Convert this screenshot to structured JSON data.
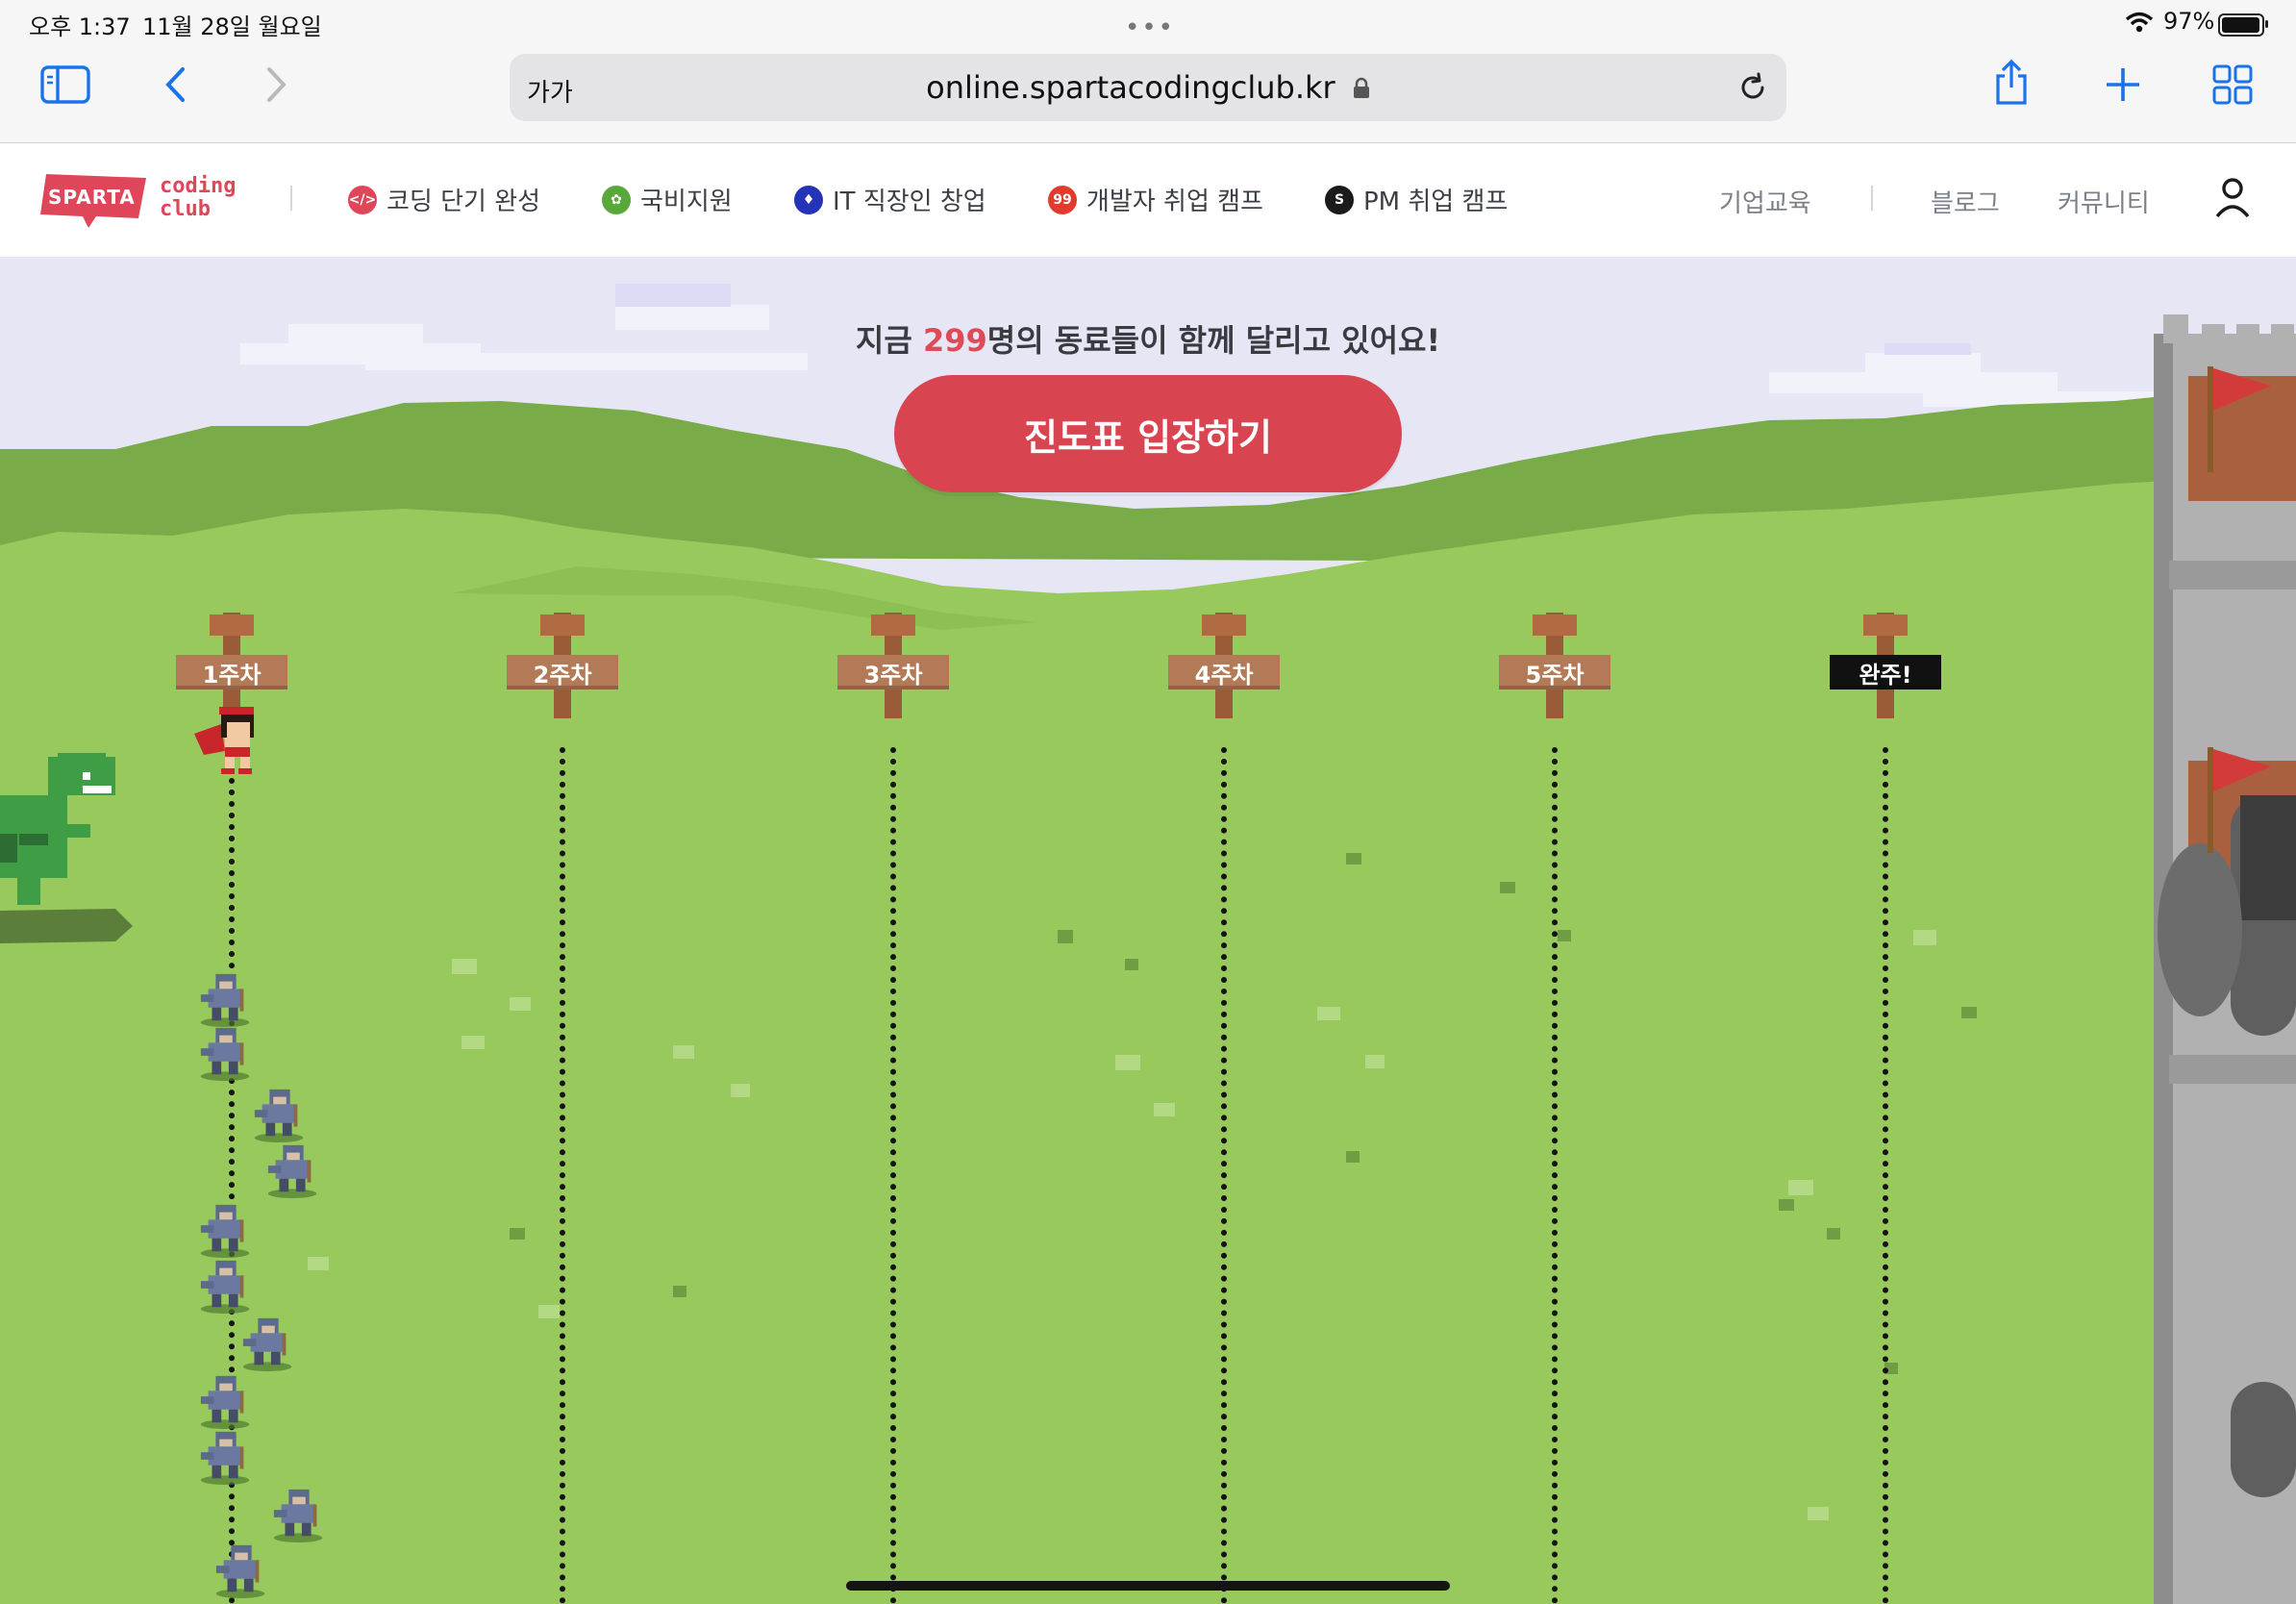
{
  "status_bar": {
    "time": "오후 1:37",
    "date": "11월 28일 월요일",
    "battery": "97%",
    "battery_level": 0.97
  },
  "browser": {
    "reader_label": "가가",
    "url": "online.spartacodingclub.kr"
  },
  "site": {
    "logo": {
      "brand": "SPARTA",
      "line1": "coding",
      "line2": "club"
    },
    "nav": [
      {
        "label": "코딩 단기 완성",
        "icon": "code-icon",
        "color": "#e0465a"
      },
      {
        "label": "국비지원",
        "icon": "sprout-icon",
        "color": "#59a83a"
      },
      {
        "label": "IT 직장인 창업",
        "icon": "flame-icon",
        "color": "#2533b8"
      },
      {
        "label": "개발자 취업 캠프",
        "icon": "99-icon",
        "color": "#e33a2e"
      },
      {
        "label": "PM 취업 캠프",
        "icon": "s-icon",
        "color": "#1b1b1b"
      }
    ],
    "right_links": {
      "b2b": "기업교육",
      "blog": "블로그",
      "community": "커뮤니티"
    }
  },
  "hero": {
    "headline_before": "지금 ",
    "count": "299",
    "headline_after": "명의 동료들이 함께 달리고 있어요!",
    "cta": "진도표 입장하기"
  },
  "milestones": [
    "1주차",
    "2주차",
    "3주차",
    "4주차",
    "5주차",
    "완주!"
  ],
  "colors": {
    "grass": "#98c95c",
    "grass_dark": "#79ab49",
    "sky": "#e6e6f5",
    "cta": "#d94451",
    "accent": "#e04a55"
  }
}
